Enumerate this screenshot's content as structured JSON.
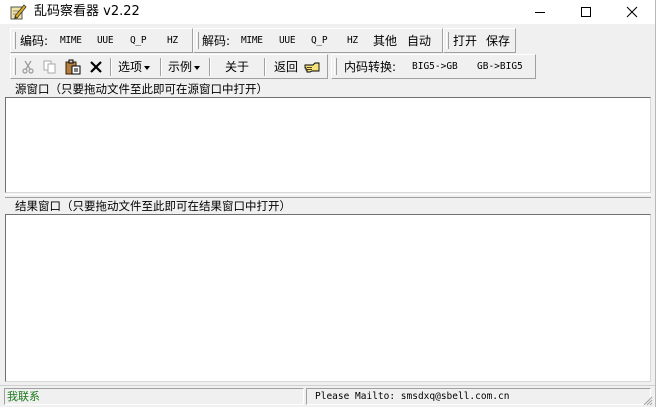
{
  "window": {
    "title": "乱码察看器 v2.22",
    "app_icon": "pencil-notepad-icon"
  },
  "toolbar1": {
    "encode_label": "编码:",
    "encode_items": [
      "MIME",
      "UUE",
      "Q_P",
      "HZ"
    ],
    "decode_label": "解码:",
    "decode_items": [
      "MIME",
      "UUE",
      "Q_P",
      "HZ",
      "其他",
      "自动"
    ],
    "file_items": [
      "打开",
      "保存"
    ]
  },
  "toolbar2": {
    "icons": [
      "cut-icon",
      "copy-icon",
      "paste-icon",
      "delete-icon"
    ],
    "options_label": "选项",
    "examples_label": "示例",
    "about_label": "关于",
    "back_label": "返回",
    "back_icon": "pointing-hand-icon",
    "convert_label": "内码转换:",
    "convert_items": [
      "BIG5->GB",
      "GB->BIG5"
    ]
  },
  "source_pane": {
    "label": "源窗口（只要拖动文件至此即可在源窗口中打开）"
  },
  "result_pane": {
    "label": "结果窗口（只要拖动文件至此即可在结果窗口中打开）"
  },
  "statusbar": {
    "contact": "我联系",
    "mailto": "Please Mailto: smsdxq@sbell.com.cn"
  }
}
